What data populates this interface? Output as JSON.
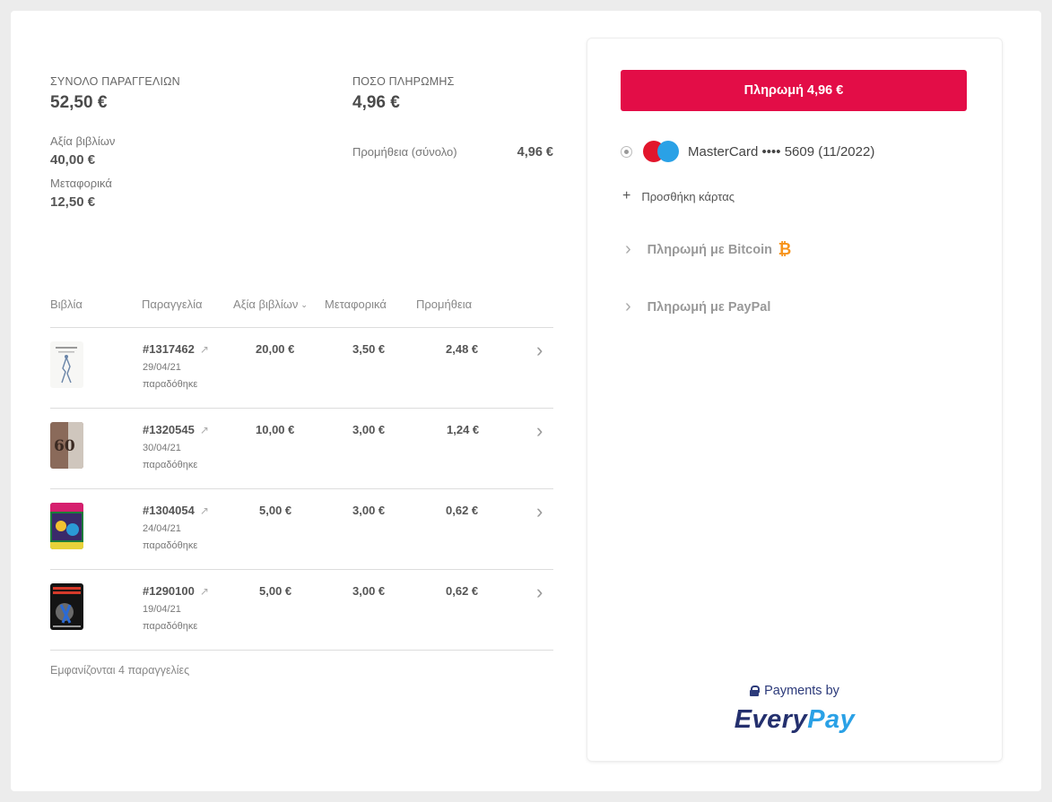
{
  "summary": {
    "total_orders_label": "ΣΥΝΟΛΟ ΠΑΡΑΓΓΕΛΙΩΝ",
    "total_orders_value": "52,50 €",
    "books_value_label": "Αξία βιβλίων",
    "books_value": "40,00 €",
    "shipping_label": "Μεταφορικά",
    "shipping_value": "12,50 €",
    "payment_amount_label": "ΠΟΣΟ ΠΛΗΡΩΜΗΣ",
    "payment_amount_value": "4,96 €",
    "commission_label": "Προμήθεια (σύνολο)",
    "commission_value": "4,96 €"
  },
  "table": {
    "headers": {
      "books": "Βιβλία",
      "order": "Παραγγελία",
      "books_value": "Αξία βιβλίων",
      "shipping": "Μεταφορικά",
      "commission": "Προμήθεια"
    },
    "rows": [
      {
        "order_id": "#1317462",
        "date": "29/04/21",
        "status": "παραδόθηκε",
        "books_value": "20,00 €",
        "shipping": "3,50 €",
        "commission": "2,48 €"
      },
      {
        "order_id": "#1320545",
        "date": "30/04/21",
        "status": "παραδόθηκε",
        "books_value": "10,00 €",
        "shipping": "3,00 €",
        "commission": "1,24 €"
      },
      {
        "order_id": "#1304054",
        "date": "24/04/21",
        "status": "παραδόθηκε",
        "books_value": "5,00 €",
        "shipping": "3,00 €",
        "commission": "0,62 €"
      },
      {
        "order_id": "#1290100",
        "date": "19/04/21",
        "status": "παραδόθηκε",
        "books_value": "5,00 €",
        "shipping": "3,00 €",
        "commission": "0,62 €"
      }
    ],
    "footer": "Εμφανίζονται 4 παραγγελίες"
  },
  "payment": {
    "pay_button": "Πληρωμή 4,96 €",
    "card_label": "MasterCard •••• 5609 (11/2022)",
    "add_card": "Προσθήκη κάρτας",
    "bitcoin_label": "Πληρωμή με Bitcoin",
    "paypal_label": "Πληρωμή με PayPal",
    "payments_by": "Payments by",
    "logo_every": "Every",
    "logo_pay": "Pay"
  },
  "colors": {
    "accent": "#e30d47",
    "everypay_navy": "#24306e",
    "everypay_blue": "#2aa1e6",
    "bitcoin": "#f7931a"
  },
  "icons": [
    "external-link-icon",
    "chevron-right-icon",
    "chevron-down-icon",
    "plus-icon",
    "lock-icon",
    "bitcoin-icon",
    "mastercard-icon",
    "radio-icon"
  ]
}
